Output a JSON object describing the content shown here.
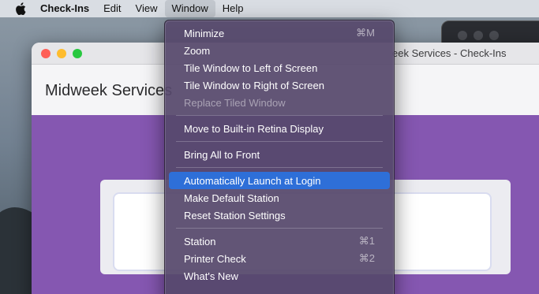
{
  "menubar": {
    "apple_icon": "apple-logo-icon",
    "app_name": "Check-Ins",
    "items": [
      "Edit",
      "View",
      "Window",
      "Help"
    ]
  },
  "window": {
    "title": "Midweek Services - Check-Ins",
    "title_visible": "eek Services - Check-Ins",
    "header": "Midweek Services",
    "header_visible": "Midweek Services",
    "accent_color": "#8557b1"
  },
  "window_menu": {
    "groups": [
      [
        {
          "label": "Minimize",
          "shortcut": "⌘M",
          "enabled": true
        },
        {
          "label": "Zoom",
          "shortcut": "",
          "enabled": true
        },
        {
          "label": "Tile Window to Left of Screen",
          "shortcut": "",
          "enabled": true
        },
        {
          "label": "Tile Window to Right of Screen",
          "shortcut": "",
          "enabled": true
        },
        {
          "label": "Replace Tiled Window",
          "shortcut": "",
          "enabled": false
        }
      ],
      [
        {
          "label": "Move to Built-in Retina Display",
          "shortcut": "",
          "enabled": true
        }
      ],
      [
        {
          "label": "Bring All to Front",
          "shortcut": "",
          "enabled": true
        }
      ],
      [
        {
          "label": "Automatically Launch at Login",
          "shortcut": "",
          "enabled": true,
          "selected": true
        },
        {
          "label": "Make Default Station",
          "shortcut": "",
          "enabled": true
        },
        {
          "label": "Reset Station Settings",
          "shortcut": "",
          "enabled": true
        }
      ],
      [
        {
          "label": "Station",
          "shortcut": "⌘1",
          "enabled": true
        },
        {
          "label": "Printer Check",
          "shortcut": "⌘2",
          "enabled": true
        },
        {
          "label": "What's New",
          "shortcut": "",
          "enabled": true
        }
      ]
    ]
  },
  "colors": {
    "menu_highlight": "#2e6fd8",
    "menu_background": "#56486c"
  }
}
